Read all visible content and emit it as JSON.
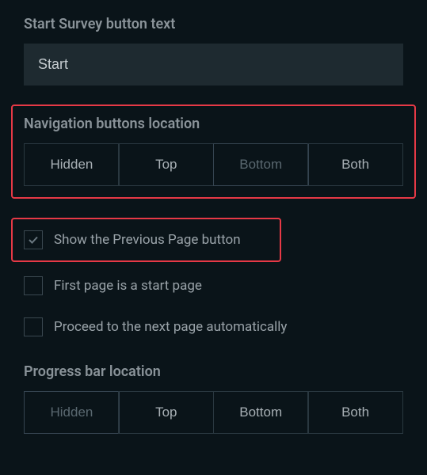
{
  "startText": {
    "label": "Start Survey button text",
    "value": "Start"
  },
  "navButtons": {
    "label": "Navigation buttons location",
    "options": [
      "Hidden",
      "Top",
      "Bottom",
      "Both"
    ]
  },
  "checkboxes": {
    "showPrevious": {
      "label": "Show the Previous Page button",
      "checked": true
    },
    "firstPageStart": {
      "label": "First page is a start page",
      "checked": false
    },
    "proceedAuto": {
      "label": "Proceed to the next page automatically",
      "checked": false
    }
  },
  "progressBar": {
    "label": "Progress bar location",
    "options": [
      "Hidden",
      "Top",
      "Bottom",
      "Both"
    ]
  }
}
